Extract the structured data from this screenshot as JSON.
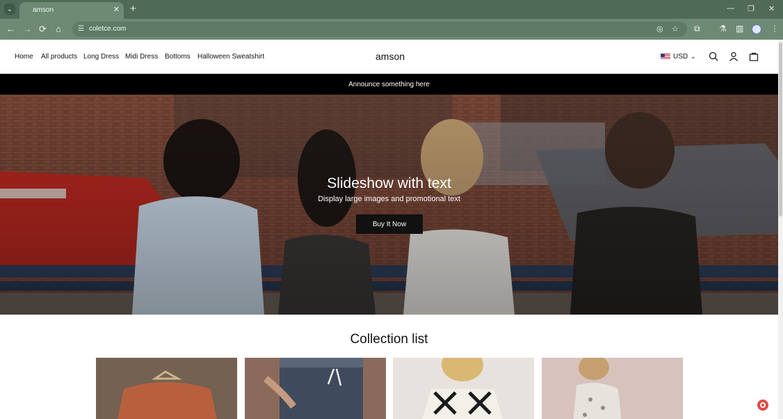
{
  "browser": {
    "tab_title": "amson",
    "url": "coletce.com",
    "tab_menu_icon": "chevron-down-icon",
    "close_icon": "close-icon",
    "new_tab_icon": "plus-icon"
  },
  "header": {
    "brand": "amson",
    "nav": [
      "Home",
      "All products",
      "Long Dress",
      "Midi Dress",
      "Bottoms",
      "Halloween Sweatshirt"
    ],
    "currency": "USD"
  },
  "announcement": "Announce something here",
  "hero": {
    "title": "Slideshow with text",
    "subtitle": "Display large images and promotional text",
    "button": "Buy It Now"
  },
  "collection": {
    "title": "Collection list"
  },
  "colors": {
    "browser_frame": "#4f6b58",
    "announcement_bg": "#000000",
    "button_bg": "#111111",
    "support_button": "#e24a4a"
  }
}
